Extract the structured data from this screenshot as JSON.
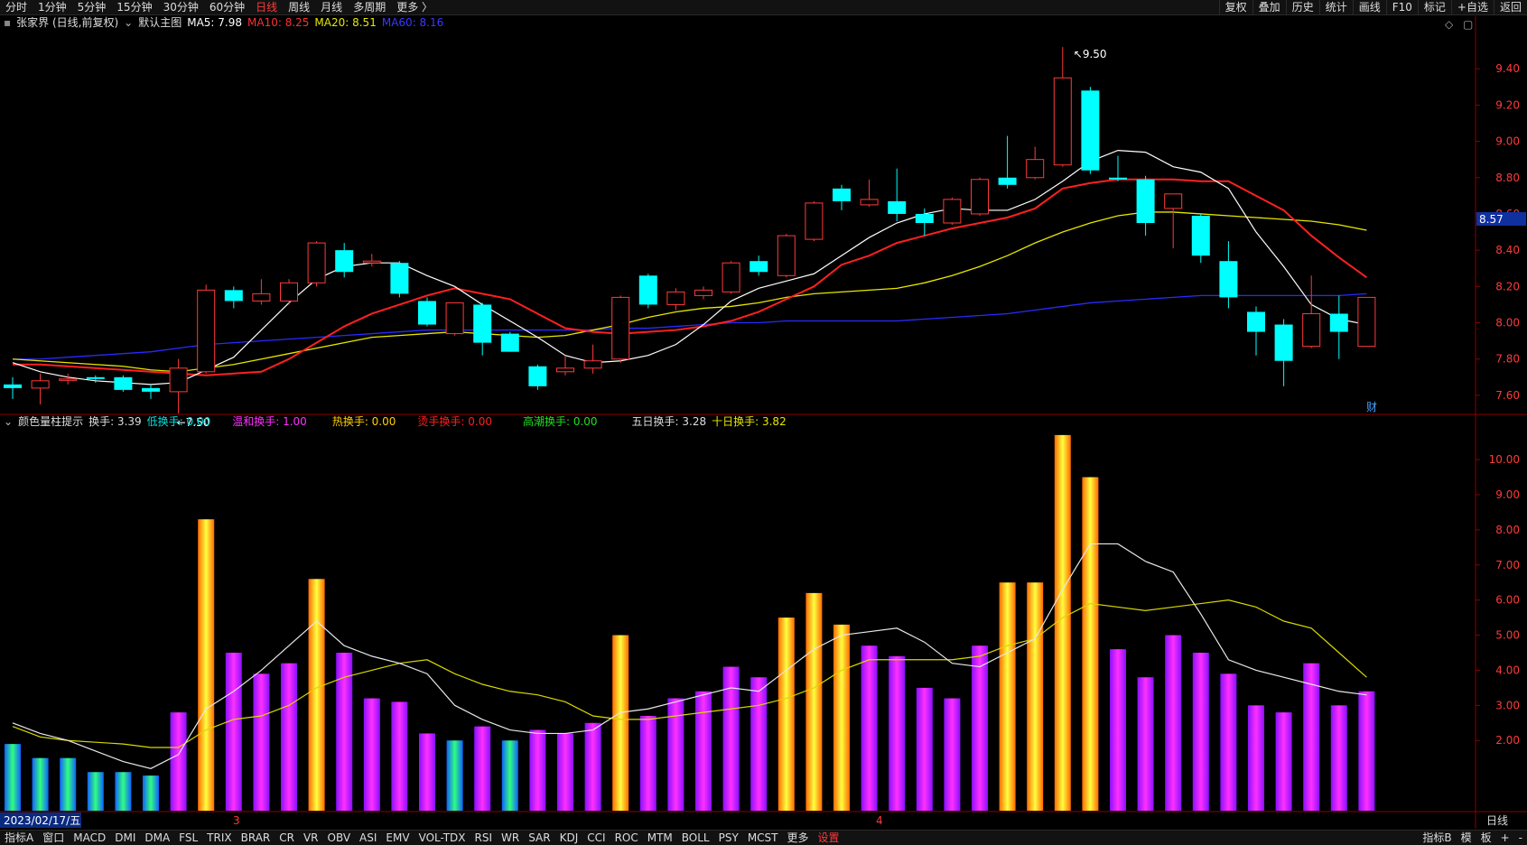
{
  "topbar": {
    "items": [
      "分时",
      "1分钟",
      "5分钟",
      "15分钟",
      "30分钟",
      "60分钟",
      "日线",
      "周线",
      "月线",
      "多周期",
      "更多 〉"
    ],
    "active": "日线",
    "right_items": [
      "复权",
      "叠加",
      "历史",
      "统计",
      "画线",
      "F10",
      "标记",
      "+自选",
      "返回"
    ]
  },
  "main_legend": {
    "stock": "张家界 (日线,前复权)",
    "template": "默认主图",
    "ma5": "MA5: 7.98",
    "ma10": "MA10: 8.25",
    "ma20": "MA20: 8.51",
    "ma60": "MA60: 8.16"
  },
  "sub_legend": {
    "name": "颜色量柱提示",
    "turnover": "换手: 3.39",
    "low": "低换手: 0.00",
    "mild": "温和换手: 1.00",
    "hot": "热换手: 0.00",
    "scorching": "烫手换手: 0.00",
    "climax": "高潮换手: 0.00",
    "five_day": "五日换手: 3.28",
    "ten_day": "十日换手: 3.82"
  },
  "price_axis": {
    "ticks": [
      "9.40",
      "9.20",
      "9.00",
      "8.80",
      "8.60",
      "8.40",
      "8.20",
      "8.00",
      "7.80",
      "7.60"
    ],
    "current": "8.57"
  },
  "sub_axis": {
    "ticks": [
      "10.00",
      "9.00",
      "8.00",
      "7.00",
      "6.00",
      "5.00",
      "4.00",
      "3.00",
      "2.00"
    ]
  },
  "date_bar": {
    "date": "2023/02/17/五",
    "month_marks": [
      "3",
      "4"
    ],
    "period": "日线"
  },
  "annotations": {
    "high": "9.50",
    "low": "7.50",
    "cai": "财"
  },
  "bottombar": {
    "items": [
      "指标A",
      "窗口",
      "MACD",
      "DMI",
      "DMA",
      "FSL",
      "TRIX",
      "BRAR",
      "CR",
      "VR",
      "OBV",
      "ASI",
      "EMV",
      "VOL-TDX",
      "RSI",
      "WR",
      "SAR",
      "KDJ",
      "CCI",
      "ROC",
      "MTM",
      "BOLL",
      "PSY",
      "MCST",
      "更多",
      "设置"
    ],
    "active": "设置",
    "right_items": [
      "指标B",
      "模",
      "板",
      "+",
      "-"
    ]
  },
  "colors": {
    "up": "#ff3a3a",
    "down": "#00ffff",
    "ma5": "#ffffff",
    "ma10": "#ff2020",
    "ma20": "#e6e600",
    "ma60": "#2a2aff",
    "axis": "#8b0000"
  },
  "chart_data": [
    {
      "type": "candlestick",
      "title": "张家界 (日线,前复权)",
      "ylim": [
        7.5,
        9.6
      ],
      "candles": [
        {
          "o": 7.66,
          "h": 7.7,
          "l": 7.58,
          "c": 7.64
        },
        {
          "o": 7.64,
          "h": 7.72,
          "l": 7.55,
          "c": 7.68
        },
        {
          "o": 7.69,
          "h": 7.72,
          "l": 7.66,
          "c": 7.69
        },
        {
          "o": 7.7,
          "h": 7.71,
          "l": 7.67,
          "c": 7.69
        },
        {
          "o": 7.7,
          "h": 7.71,
          "l": 7.62,
          "c": 7.63
        },
        {
          "o": 7.64,
          "h": 7.66,
          "l": 7.58,
          "c": 7.62
        },
        {
          "o": 7.62,
          "h": 7.8,
          "l": 7.5,
          "c": 7.75
        },
        {
          "o": 7.73,
          "h": 8.21,
          "l": 7.72,
          "c": 8.18
        },
        {
          "o": 8.18,
          "h": 8.2,
          "l": 8.08,
          "c": 8.12
        },
        {
          "o": 8.12,
          "h": 8.24,
          "l": 8.1,
          "c": 8.16
        },
        {
          "o": 8.12,
          "h": 8.24,
          "l": 8.1,
          "c": 8.22
        },
        {
          "o": 8.22,
          "h": 8.45,
          "l": 8.2,
          "c": 8.44
        },
        {
          "o": 8.4,
          "h": 8.44,
          "l": 8.25,
          "c": 8.28
        },
        {
          "o": 8.33,
          "h": 8.38,
          "l": 8.31,
          "c": 8.34
        },
        {
          "o": 8.33,
          "h": 8.34,
          "l": 8.14,
          "c": 8.16
        },
        {
          "o": 8.12,
          "h": 8.14,
          "l": 7.98,
          "c": 7.99
        },
        {
          "o": 7.94,
          "h": 8.11,
          "l": 7.93,
          "c": 8.11
        },
        {
          "o": 8.1,
          "h": 8.11,
          "l": 7.82,
          "c": 7.89
        },
        {
          "o": 7.94,
          "h": 7.95,
          "l": 7.84,
          "c": 7.84
        },
        {
          "o": 7.76,
          "h": 7.77,
          "l": 7.63,
          "c": 7.65
        },
        {
          "o": 7.73,
          "h": 7.82,
          "l": 7.71,
          "c": 7.75
        },
        {
          "o": 7.75,
          "h": 7.88,
          "l": 7.72,
          "c": 7.79
        },
        {
          "o": 7.8,
          "h": 8.15,
          "l": 7.78,
          "c": 8.14
        },
        {
          "o": 8.26,
          "h": 8.27,
          "l": 8.08,
          "c": 8.1
        },
        {
          "o": 8.1,
          "h": 8.19,
          "l": 8.07,
          "c": 8.17
        },
        {
          "o": 8.15,
          "h": 8.2,
          "l": 8.13,
          "c": 8.18
        },
        {
          "o": 8.17,
          "h": 8.34,
          "l": 8.16,
          "c": 8.33
        },
        {
          "o": 8.34,
          "h": 8.37,
          "l": 8.26,
          "c": 8.28
        },
        {
          "o": 8.26,
          "h": 8.49,
          "l": 8.25,
          "c": 8.48
        },
        {
          "o": 8.46,
          "h": 8.67,
          "l": 8.45,
          "c": 8.66
        },
        {
          "o": 8.74,
          "h": 8.76,
          "l": 8.62,
          "c": 8.67
        },
        {
          "o": 8.65,
          "h": 8.79,
          "l": 8.64,
          "c": 8.68
        },
        {
          "o": 8.67,
          "h": 8.85,
          "l": 8.56,
          "c": 8.6
        },
        {
          "o": 8.6,
          "h": 8.63,
          "l": 8.48,
          "c": 8.55
        },
        {
          "o": 8.55,
          "h": 8.69,
          "l": 8.54,
          "c": 8.68
        },
        {
          "o": 8.6,
          "h": 8.8,
          "l": 8.59,
          "c": 8.79
        },
        {
          "o": 8.8,
          "h": 9.03,
          "l": 8.74,
          "c": 8.76
        },
        {
          "o": 8.8,
          "h": 8.97,
          "l": 8.79,
          "c": 8.9
        },
        {
          "o": 8.87,
          "h": 9.52,
          "l": 8.86,
          "c": 9.35
        },
        {
          "o": 9.28,
          "h": 9.3,
          "l": 8.82,
          "c": 8.84
        },
        {
          "o": 8.8,
          "h": 8.92,
          "l": 8.78,
          "c": 8.79
        },
        {
          "o": 8.79,
          "h": 8.81,
          "l": 8.48,
          "c": 8.55
        },
        {
          "o": 8.63,
          "h": 8.71,
          "l": 8.41,
          "c": 8.71
        },
        {
          "o": 8.59,
          "h": 8.6,
          "l": 8.33,
          "c": 8.37
        },
        {
          "o": 8.34,
          "h": 8.45,
          "l": 8.08,
          "c": 8.14
        },
        {
          "o": 8.06,
          "h": 8.09,
          "l": 7.82,
          "c": 7.95
        },
        {
          "o": 7.99,
          "h": 8.02,
          "l": 7.65,
          "c": 7.79
        },
        {
          "o": 7.87,
          "h": 8.26,
          "l": 7.86,
          "c": 8.05
        },
        {
          "o": 8.05,
          "h": 8.15,
          "l": 7.8,
          "c": 7.95
        },
        {
          "o": 7.87,
          "h": 8.14,
          "l": 7.87,
          "c": 8.14
        }
      ],
      "ma5": [
        7.78,
        7.73,
        7.7,
        7.68,
        7.67,
        7.66,
        7.67,
        7.74,
        7.81,
        7.96,
        8.11,
        8.24,
        8.31,
        8.33,
        8.33,
        8.26,
        8.2,
        8.1,
        8.01,
        7.92,
        7.82,
        7.78,
        7.79,
        7.82,
        7.88,
        7.99,
        8.12,
        8.19,
        8.23,
        8.27,
        8.37,
        8.47,
        8.55,
        8.6,
        8.63,
        8.62,
        8.62,
        8.68,
        8.78,
        8.89,
        8.95,
        8.94,
        8.86,
        8.83,
        8.74,
        8.5,
        8.31,
        8.1,
        8.02,
        7.99
      ],
      "ma10": [
        7.77,
        7.77,
        7.76,
        7.75,
        7.74,
        7.73,
        7.72,
        7.71,
        7.72,
        7.73,
        7.8,
        7.89,
        7.98,
        8.05,
        8.1,
        8.15,
        8.19,
        8.16,
        8.13,
        8.05,
        7.97,
        7.95,
        7.94,
        7.95,
        7.96,
        7.98,
        8.01,
        8.06,
        8.13,
        8.2,
        8.32,
        8.37,
        8.44,
        8.48,
        8.52,
        8.55,
        8.58,
        8.63,
        8.74,
        8.77,
        8.79,
        8.79,
        8.79,
        8.78,
        8.78,
        8.7,
        8.62,
        8.48,
        8.36,
        8.25
      ],
      "ma20": [
        7.8,
        7.79,
        7.78,
        7.77,
        7.76,
        7.74,
        7.73,
        7.75,
        7.77,
        7.8,
        7.83,
        7.86,
        7.89,
        7.92,
        7.93,
        7.94,
        7.95,
        7.94,
        7.93,
        7.92,
        7.93,
        7.96,
        7.99,
        8.03,
        8.06,
        8.08,
        8.09,
        8.11,
        8.14,
        8.16,
        8.17,
        8.18,
        8.19,
        8.22,
        8.26,
        8.31,
        8.37,
        8.44,
        8.5,
        8.55,
        8.59,
        8.61,
        8.61,
        8.6,
        8.59,
        8.58,
        8.57,
        8.56,
        8.54,
        8.51
      ],
      "ma60": [
        7.8,
        7.8,
        7.81,
        7.82,
        7.83,
        7.84,
        7.86,
        7.88,
        7.89,
        7.9,
        7.91,
        7.92,
        7.93,
        7.94,
        7.95,
        7.96,
        7.96,
        7.96,
        7.96,
        7.96,
        7.96,
        7.96,
        7.97,
        7.97,
        7.98,
        7.99,
        8.0,
        8.0,
        8.01,
        8.01,
        8.01,
        8.01,
        8.01,
        8.02,
        8.03,
        8.04,
        8.05,
        8.07,
        8.09,
        8.11,
        8.12,
        8.13,
        8.14,
        8.15,
        8.15,
        8.15,
        8.15,
        8.15,
        8.15,
        8.16
      ]
    },
    {
      "type": "bar",
      "title": "颜色量柱提示",
      "ylim": [
        0,
        10.8
      ],
      "values": [
        1.9,
        1.5,
        1.5,
        1.1,
        1.1,
        1.0,
        2.8,
        8.3,
        4.5,
        3.9,
        4.2,
        6.6,
        4.5,
        3.2,
        3.1,
        2.2,
        2.0,
        2.4,
        2.0,
        2.3,
        2.2,
        2.5,
        5.0,
        2.7,
        3.2,
        3.4,
        4.1,
        3.8,
        5.5,
        6.2,
        5.3,
        4.7,
        4.4,
        3.5,
        3.2,
        4.7,
        6.5,
        6.5,
        10.7,
        9.5,
        4.6,
        3.8,
        5.0,
        4.5,
        3.9,
        3.0,
        2.8,
        4.2,
        3.0,
        3.4
      ],
      "categories_by_color": [
        1,
        1,
        1,
        1,
        1,
        1,
        2,
        3,
        2,
        2,
        2,
        3,
        2,
        2,
        2,
        2,
        1,
        2,
        1,
        2,
        2,
        2,
        3,
        2,
        2,
        2,
        2,
        2,
        3,
        3,
        3,
        2,
        2,
        2,
        2,
        2,
        3,
        3,
        3,
        3,
        2,
        2,
        2,
        2,
        2,
        2,
        2,
        2,
        2,
        2
      ],
      "five_day": [
        2.5,
        2.2,
        2.0,
        1.7,
        1.4,
        1.2,
        1.6,
        2.9,
        3.4,
        4.0,
        4.7,
        5.4,
        4.7,
        4.4,
        4.2,
        3.9,
        3.0,
        2.6,
        2.3,
        2.2,
        2.2,
        2.3,
        2.8,
        2.9,
        3.1,
        3.3,
        3.5,
        3.4,
        4.0,
        4.6,
        5.0,
        5.1,
        5.2,
        4.8,
        4.2,
        4.1,
        4.5,
        4.9,
        6.3,
        7.6,
        7.6,
        7.1,
        6.8,
        5.6,
        4.3,
        4.0,
        3.8,
        3.6,
        3.4,
        3.3
      ],
      "ten_day": [
        2.4,
        2.1,
        2.0,
        1.95,
        1.9,
        1.8,
        1.8,
        2.3,
        2.6,
        2.7,
        3.0,
        3.5,
        3.8,
        4.0,
        4.2,
        4.3,
        3.9,
        3.6,
        3.4,
        3.3,
        3.1,
        2.7,
        2.6,
        2.6,
        2.7,
        2.8,
        2.9,
        3.0,
        3.2,
        3.5,
        4.0,
        4.3,
        4.3,
        4.3,
        4.3,
        4.4,
        4.7,
        4.9,
        5.5,
        5.9,
        5.8,
        5.7,
        5.8,
        5.9,
        6.0,
        5.8,
        5.4,
        5.2,
        4.5,
        3.8
      ]
    }
  ]
}
